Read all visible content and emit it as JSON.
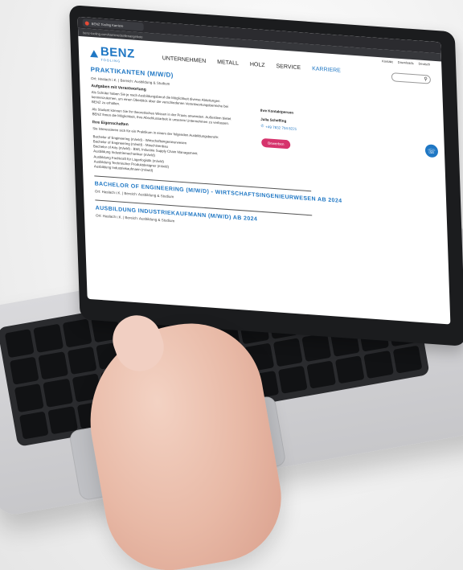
{
  "browser": {
    "tab_title": "BENZ Tooling Karriere",
    "url_text": "benz-tooling.com/karriere/stellenangebote"
  },
  "site": {
    "logo": {
      "name": "BENZ",
      "tagline": "TOOLING",
      "accent": "#1f77c4"
    },
    "nav": [
      {
        "label": "UNTERNEHMEN"
      },
      {
        "label": "METALL"
      },
      {
        "label": "HOLZ"
      },
      {
        "label": "SERVICE"
      },
      {
        "label": "KARRIERE"
      }
    ],
    "top_links": [
      "Kontakt",
      "Downloads",
      "Deutsch"
    ],
    "search": {
      "placeholder": ""
    }
  },
  "posting": {
    "title": "PRAKTIKANTEN (M/W/D)",
    "meta": "Ort: Haslach i.K. | Bereich: Ausbildung & Studium",
    "section_title": "Aufgaben mit Verantwortung",
    "para1": "Als Schüler haben Sie je nach Ausbildungsberuf die Möglichkeit diverse Abteilungen kennenzulernen, um einen Überblick über die verschiedenen Verantwortungsbereiche bei BENZ zu erhalten.",
    "para2": "Als Student können Sie Ihr theoretisches Wissen in der Praxis anwenden. Außerdem bietet BENZ Ihnen die Möglichkeit, Ihre Abschlussarbeit in unserem Unternehmen zu verfassen.",
    "subline": "Ihre Eigenschaften",
    "interest": "Sie interessieren sich für ein Praktikum in einem der folgenden Ausbildungsberufe:",
    "list": [
      "Bachelor of Engineering (m/w/d) - Wirtschaftsingenieurwesen",
      "Bachelor of Engineering (m/w/d) - Maschinenbau",
      "Bachelor of Arts (m/w/d) - BWL Industrie Supply Chain Management",
      "Ausbildung Industriemechaniker (m/w/d)",
      "Ausbildung Fachkraft für Lagerlogistik (m/w/d)",
      "Ausbildung Technischer Produktdesigner (m/w/d)",
      "Ausbildung Industriekaufmann (m/w/d)"
    ]
  },
  "contact": {
    "label": "Ihre Kontaktperson",
    "name": "Julia Scheffing",
    "phone": "+49 7832 704 8221",
    "apply_label": "Bewerben"
  },
  "jobs": [
    {
      "title": "BACHELOR OF ENGINEERING (M/W/D) - WIRTSCHAFTSINGENIEURWESEN AB 2024",
      "meta": "Ort: Haslach i.K. | Bereich: Ausbildung & Studium"
    },
    {
      "title": "AUSBILDUNG INDUSTRIEKAUFMANN (M/W/D) AB 2024",
      "meta": "Ort: Haslach i.K. | Bereich: Ausbildung & Studium"
    }
  ]
}
